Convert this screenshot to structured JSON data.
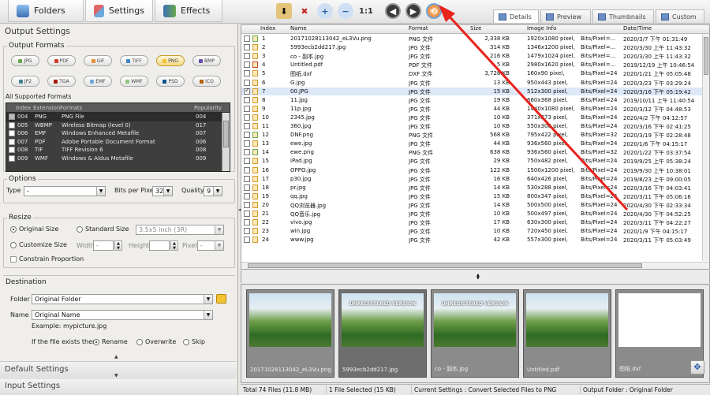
{
  "toolbar": {
    "tabs": [
      {
        "label": "Folders",
        "icon": "folder-icon"
      },
      {
        "label": "Settings",
        "icon": "settings-icon"
      },
      {
        "label": "Effects",
        "icon": "effects-icon"
      }
    ],
    "actions": [
      "download-icon",
      "delete-icon",
      "zoom-in-icon",
      "zoom-out-icon",
      "actual-size-icon",
      "rotate-left-icon",
      "rotate-right-icon",
      "convert-icon"
    ],
    "actual_size_label": "1:1",
    "view_tabs": [
      "Details",
      "Preview",
      "Thumbnails",
      "Custom"
    ],
    "view_active": "Details"
  },
  "settings": {
    "title": "Output Settings",
    "output_formats_title": "Output Formats",
    "formats": [
      {
        "label": "JPG",
        "color": "#6aa84f",
        "selected": false
      },
      {
        "label": "PDF",
        "color": "#cc4125",
        "selected": false
      },
      {
        "label": "GIF",
        "color": "#e69138",
        "selected": false
      },
      {
        "label": "TIFF",
        "color": "#3d85c6",
        "selected": false
      },
      {
        "label": "PNG",
        "color": "#f1c232",
        "selected": true
      },
      {
        "label": "BMP",
        "color": "#674ea7",
        "selected": false
      },
      {
        "label": "JP2",
        "color": "#45818e",
        "selected": false
      },
      {
        "label": "TGA",
        "color": "#a61c00",
        "selected": false
      },
      {
        "label": "EMF",
        "color": "#6fa8dc",
        "selected": false
      },
      {
        "label": "WMF",
        "color": "#93c47d",
        "selected": false
      },
      {
        "label": "PSD",
        "color": "#0b5394",
        "selected": false
      },
      {
        "label": "ICO",
        "color": "#b45f06",
        "selected": false
      }
    ],
    "all_formats_label": "All Supported Formats",
    "format_columns": [
      "Index",
      "Extension",
      "Formats",
      "Popularity"
    ],
    "format_rows": [
      {
        "index": "004",
        "ext": "PNG",
        "name": "PNG File",
        "pop": "004",
        "checked": true
      },
      {
        "index": "005",
        "ext": "WBMP",
        "name": "Wireless Bitmap (level 0)",
        "pop": "017",
        "checked": false
      },
      {
        "index": "006",
        "ext": "EMF",
        "name": "Windows Enhanced Metafile",
        "pop": "007",
        "checked": false
      },
      {
        "index": "007",
        "ext": "PDF",
        "name": "Adobe Portable Document Format",
        "pop": "006",
        "checked": false
      },
      {
        "index": "008",
        "ext": "TIF",
        "name": "TIFF Revision 6",
        "pop": "008",
        "checked": false
      },
      {
        "index": "009",
        "ext": "WMF",
        "name": "Windows & Aldus Metafile",
        "pop": "009",
        "checked": false
      }
    ],
    "options_title": "Options",
    "type_label": "Type",
    "type_value": "-",
    "bpp_label": "Bits per Pixel",
    "bpp_value": "32",
    "quality_label": "Quality",
    "quality_value": "9",
    "resize_title": "Resize",
    "original_size": "Original Size",
    "standard_size": "Standard Size",
    "standard_value": "3.5x5 inch (3R)",
    "customize_size": "Customize Size",
    "width_label": "Width",
    "width_value": "-",
    "height_label": "Height",
    "pixel_label": "Pixel",
    "pixel_value": "-",
    "constrain_label": "Constrain Proportion",
    "destination_title": "Destination",
    "folder_label": "Folder",
    "folder_value": "Original Folder",
    "name_label": "Name",
    "name_value": "Original Name",
    "example_label": "Example: mypicture.jpg",
    "exists_label": "If the file exists then",
    "rename_label": "Rename",
    "overwrite_label": "Overwrite",
    "skip_label": "Skip",
    "default_settings": "Default Settings",
    "input_settings": "Input Settings"
  },
  "grid": {
    "columns": [
      "Index",
      "Name",
      "Format",
      "Size",
      "Image Info",
      "Date/Time"
    ],
    "rows": [
      {
        "index": "1",
        "name": "20171028113042_eL3Vu.png",
        "format": "PNG 文件",
        "size": "2,338 KB",
        "info": "1920x1080 pixel,",
        "bits": "Bits/Pixel=...",
        "date": "2020/3/7 下午 01:31:49",
        "icon": "#6aa84f",
        "checked": false
      },
      {
        "index": "2",
        "name": "5993ecb2dd217.jpg",
        "format": "JPG 文件",
        "size": "314 KB",
        "info": "1346x1200 pixel,",
        "bits": "Bits/Pixel=...",
        "date": "2020/3/30 上午 11:43:32",
        "icon": "#d49b2b",
        "checked": false
      },
      {
        "index": "3",
        "name": "co - 副本.jpg",
        "format": "JPG 文件",
        "size": "216 KB",
        "info": "1479x1024 pixel,",
        "bits": "Bits/Pixel=...",
        "date": "2020/3/30 上午 11:43:32",
        "icon": "#d49b2b",
        "checked": false
      },
      {
        "index": "4",
        "name": "Untitled.pdf",
        "format": "PDF 文件",
        "size": "5 KB",
        "info": "2980x1620 pixel,",
        "bits": "Bits/Pixel=...",
        "date": "2019/12/19 上午 10:46:54",
        "icon": "#cc4125",
        "checked": false
      },
      {
        "index": "5",
        "name": "图纸.dxf",
        "format": "DXF 文件",
        "size": "3,728 KB",
        "info": "160x90 pixel,",
        "bits": "Bits/Pixel=24",
        "date": "2020/1/21 上午 05:05:48",
        "icon": "#d49b2b",
        "checked": false
      },
      {
        "index": "6",
        "name": "G.jpg",
        "format": "JPG 文件",
        "size": "13 KB",
        "info": "950x443 pixel,",
        "bits": "Bits/Pixel=24",
        "date": "2020/3/23 下午 03:29:24",
        "icon": "#d49b2b",
        "checked": false
      },
      {
        "index": "7",
        "name": "00.JPG",
        "format": "JPG 文件",
        "size": "15 KB",
        "info": "512x300 pixel,",
        "bits": "Bits/Pixel=24",
        "date": "2020/3/16 下午 05:19:42",
        "icon": "#d49b2b",
        "checked": true
      },
      {
        "index": "8",
        "name": "11.jpg",
        "format": "JPG 文件",
        "size": "19 KB",
        "info": "660x368 pixel,",
        "bits": "Bits/Pixel=24",
        "date": "2019/10/11 上午 11:40:54",
        "icon": "#d49b2b",
        "checked": false
      },
      {
        "index": "9",
        "name": "11p.jpg",
        "format": "JPG 文件",
        "size": "44 KB",
        "info": "1440x1080 pixel,",
        "bits": "Bits/Pixel=24",
        "date": "2020/3/12 下午 04:48:53",
        "icon": "#d49b2b",
        "checked": false
      },
      {
        "index": "10",
        "name": "2345.jpg",
        "format": "JPG 文件",
        "size": "10 KB",
        "info": "371x373 pixel,",
        "bits": "Bits/Pixel=24",
        "date": "2020/4/2 下午 04:12:57",
        "icon": "#d49b2b",
        "checked": false
      },
      {
        "index": "11",
        "name": "360.jpg",
        "format": "JPG 文件",
        "size": "10 KB",
        "info": "550x300 pixel,",
        "bits": "Bits/Pixel=24",
        "date": "2020/3/16 下午 02:41:25",
        "icon": "#d49b2b",
        "checked": false
      },
      {
        "index": "12",
        "name": "DNF.png",
        "format": "PNG 文件",
        "size": "568 KB",
        "info": "795x422 pixel,",
        "bits": "Bits/Pixel=32",
        "date": "2020/3/19 下午 02:28:48",
        "icon": "#6aa84f",
        "checked": false
      },
      {
        "index": "13",
        "name": "ewe.jpg",
        "format": "JPG 文件",
        "size": "44 KB",
        "info": "936x560 pixel,",
        "bits": "Bits/Pixel=24",
        "date": "2020/1/6 下午 04:15:17",
        "icon": "#d49b2b",
        "checked": false
      },
      {
        "index": "14",
        "name": "ewe.png",
        "format": "PNG 文件",
        "size": "638 KB",
        "info": "936x560 pixel,",
        "bits": "Bits/Pixel=32",
        "date": "2020/1/22 下午 03:37:54",
        "icon": "#6aa84f",
        "checked": false
      },
      {
        "index": "15",
        "name": "iPad.jpg",
        "format": "JPG 文件",
        "size": "29 KB",
        "info": "750x482 pixel,",
        "bits": "Bits/Pixel=24",
        "date": "2019/9/25 上午 05:38:24",
        "icon": "#d49b2b",
        "checked": false
      },
      {
        "index": "16",
        "name": "OPPO.jpg",
        "format": "JPG 文件",
        "size": "122 KB",
        "info": "1500x1200 pixel,",
        "bits": "Bits/Pixel=24",
        "date": "2019/9/30 上午 10:38:01",
        "icon": "#d49b2b",
        "checked": false
      },
      {
        "index": "17",
        "name": "p30.jpg",
        "format": "JPG 文件",
        "size": "16 KB",
        "info": "640x426 pixel,",
        "bits": "Bits/Pixel=24",
        "date": "2019/8/23 上午 09:00:05",
        "icon": "#d49b2b",
        "checked": false
      },
      {
        "index": "18",
        "name": "pr.jpg",
        "format": "JPG 文件",
        "size": "14 KB",
        "info": "530x288 pixel,",
        "bits": "Bits/Pixel=24",
        "date": "2020/3/16 下午 04:03:41",
        "icon": "#d49b2b",
        "checked": false
      },
      {
        "index": "19",
        "name": "qq.jpg",
        "format": "JPG 文件",
        "size": "15 KB",
        "info": "800x347 pixel,",
        "bits": "Bits/Pixel=24",
        "date": "2020/3/11 下午 05:06:16",
        "icon": "#d49b2b",
        "checked": false
      },
      {
        "index": "20",
        "name": "QQ浏览器.jpg",
        "format": "JPG 文件",
        "size": "14 KB",
        "info": "500x500 pixel,",
        "bits": "Bits/Pixel=24",
        "date": "2020/4/30 下午 02:33:34",
        "icon": "#d49b2b",
        "checked": false
      },
      {
        "index": "21",
        "name": "QQ音乐.jpg",
        "format": "JPG 文件",
        "size": "10 KB",
        "info": "500x497 pixel,",
        "bits": "Bits/Pixel=24",
        "date": "2020/4/30 下午 04:52:25",
        "icon": "#d49b2b",
        "checked": false
      },
      {
        "index": "22",
        "name": "vivo.jpg",
        "format": "JPG 文件",
        "size": "17 KB",
        "info": "630x300 pixel,",
        "bits": "Bits/Pixel=24",
        "date": "2020/3/11 下午 04:22:27",
        "icon": "#d49b2b",
        "checked": false
      },
      {
        "index": "23",
        "name": "win.jpg",
        "format": "JPG 文件",
        "size": "10 KB",
        "info": "720x450 pixel,",
        "bits": "Bits/Pixel=24",
        "date": "2020/1/9 下午 04:15:17",
        "icon": "#d49b2b",
        "checked": false
      },
      {
        "index": "24",
        "name": "www.jpg",
        "format": "JPG 文件",
        "size": "42 KB",
        "info": "557x300 pixel,",
        "bits": "Bits/Pixel=24",
        "date": "2020/3/11 下午 05:03:49",
        "icon": "#d49b2b",
        "checked": false
      }
    ]
  },
  "thumbnails": [
    {
      "name": "20171028113042_eL3Vu.png",
      "kind": "photo",
      "watermark": false
    },
    {
      "name": "5993ecb2dd217.jpg",
      "kind": "photo",
      "watermark": true
    },
    {
      "name": "co - 副本.jpg",
      "kind": "photo",
      "watermark": true
    },
    {
      "name": "Untitled.pdf",
      "kind": "photo",
      "watermark": false
    },
    {
      "name": "图纸.dxf",
      "kind": "blank",
      "watermark": false
    }
  ],
  "watermark_text": "UNREGISTERED VERSION",
  "status": {
    "total": "Total 74 Files (11.8 MB)",
    "selected": "1 File Selected (15 KB)",
    "current": "Current Settings : Convert Selected Files to PNG",
    "output": "Output Folder : Original Folder"
  },
  "colors": {
    "accent": "#3d6fb6",
    "arrow": "#e8231c",
    "selection": "#dde8f8"
  }
}
